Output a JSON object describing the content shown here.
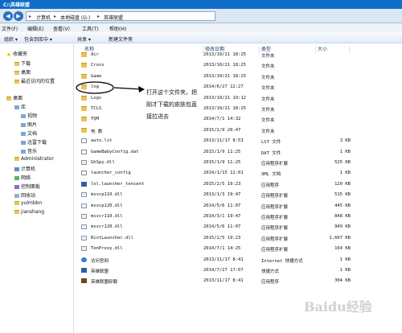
{
  "window": {
    "title": "C:\\英雄联盟"
  },
  "nav": {
    "back": "◀",
    "forward": "▶"
  },
  "address": {
    "c1": "计算机",
    "c2": "本地磁盘 (G:)",
    "c3": "英雄联盟",
    "sep": "▸"
  },
  "menu": {
    "file": "文件(F)",
    "edit": "编辑(E)",
    "view": "查看(V)",
    "tools": "工具(T)",
    "help": "帮助(H)"
  },
  "toolbar": {
    "organize": "组织 ▾",
    "include": "包含到库中 ▾",
    "share": "共享 ▾",
    "newfolder": "新建文件夹"
  },
  "sidebar": [
    {
      "label": "收藏夹",
      "icon": "star-icon"
    },
    {
      "label": "下载",
      "icon": "folder-icon"
    },
    {
      "label": "桌面",
      "icon": "folder-icon"
    },
    {
      "label": "最近访问的位置",
      "icon": "folder-icon"
    },
    {
      "label": "桌面",
      "icon": "folder-icon"
    },
    {
      "label": "库",
      "icon": "library-icon"
    },
    {
      "label": "视频",
      "icon": "library-icon"
    },
    {
      "label": "图片",
      "icon": "library-icon"
    },
    {
      "label": "文档",
      "icon": "library-icon"
    },
    {
      "label": "迅雷下载",
      "icon": "library-icon"
    },
    {
      "label": "音乐",
      "icon": "library-icon"
    },
    {
      "label": "Administrator",
      "icon": "folder-icon"
    },
    {
      "label": "计算机",
      "icon": "computer-icon"
    },
    {
      "label": "网络",
      "icon": "network-icon"
    },
    {
      "label": "控制面板",
      "icon": "control-panel-icon"
    },
    {
      "label": "回收站",
      "icon": "recycle-bin-icon"
    },
    {
      "label": "yulmbbn",
      "icon": "folder-icon"
    },
    {
      "label": "jianshang",
      "icon": "folder-icon"
    }
  ],
  "columns": {
    "name": "名称",
    "date": "修改日期",
    "type": "类型",
    "size": "大小"
  },
  "files": [
    {
      "name": "Air",
      "date": "2013/10/21 18:25",
      "type": "文件夹",
      "size": "",
      "kind": "folder"
    },
    {
      "name": "Cross",
      "date": "2013/10/21 18:25",
      "type": "文件夹",
      "size": "",
      "kind": "folder"
    },
    {
      "name": "Game",
      "date": "2013/10/21 18:25",
      "type": "文件夹",
      "size": "",
      "kind": "folder"
    },
    {
      "name": "log",
      "date": "2014/6/27 12:27",
      "type": "文件夹",
      "size": "",
      "kind": "folder"
    },
    {
      "name": "Logs",
      "date": "2013/10/21 19:12",
      "type": "文件夹",
      "size": "",
      "kind": "folder"
    },
    {
      "name": "TCLS",
      "date": "2013/10/21 18:25",
      "type": "文件夹",
      "size": "",
      "kind": "folder"
    },
    {
      "name": "TQM",
      "date": "2014/7/1 14:32",
      "type": "文件夹",
      "size": "",
      "kind": "folder"
    },
    {
      "name": "电 数",
      "date": "2015/2/9 20:47",
      "type": "文件夹",
      "size": "",
      "kind": "folder"
    },
    {
      "name": "auto.lst",
      "date": "2013/11/17 8:53",
      "type": "LST 文件",
      "size": "3 KB",
      "kind": "file"
    },
    {
      "name": "GameBabyConfig.dat",
      "date": "2015/1/9 11:25",
      "type": "DAT 文件",
      "size": "1 KB",
      "kind": "file"
    },
    {
      "name": "GhSpy.dll",
      "date": "2015/1/9 11:25",
      "type": "应用程序扩展",
      "size": "525 KB",
      "kind": "dll"
    },
    {
      "name": "launcher_config",
      "date": "2014/1/15 12:01",
      "type": "XML 文档",
      "size": "1 KB",
      "kind": "file"
    },
    {
      "name": "lol.launcher_tencent",
      "date": "2015/2/5 19:23",
      "type": "应用程序",
      "size": "120 KB",
      "kind": "app"
    },
    {
      "name": "msvcp110.dll",
      "date": "2013/1/3 19:47",
      "type": "应用程序扩展",
      "size": "515 KB",
      "kind": "dll"
    },
    {
      "name": "msvcp120.dll",
      "date": "2014/5/6 11:07",
      "type": "应用程序扩展",
      "size": "445 KB",
      "kind": "dll"
    },
    {
      "name": "msvcr110.dll",
      "date": "2014/3/1 19:47",
      "type": "应用程序扩展",
      "size": "848 KB",
      "kind": "dll"
    },
    {
      "name": "msvcr120.dll",
      "date": "2014/5/6 11:07",
      "type": "应用程序扩展",
      "size": "949 KB",
      "kind": "dll"
    },
    {
      "name": "RiotLauncher.dll",
      "date": "2015/2/5 19:23",
      "type": "应用程序扩展",
      "size": "1,607 KB",
      "kind": "dll"
    },
    {
      "name": "TenProxy.dll",
      "date": "2014/7/1 14:25",
      "type": "应用程序扩展",
      "size": "164 KB",
      "kind": "dll"
    },
    {
      "name": "访问官网",
      "date": "2013/11/17 8:41",
      "type": "Internet 快捷方式",
      "size": "1 KB",
      "kind": "web"
    },
    {
      "name": "英雄联盟",
      "date": "2014/7/27 17:07",
      "type": "快捷方式",
      "size": "1 KB",
      "kind": "app"
    },
    {
      "name": "英雄联盟卸载",
      "date": "2013/11/17 8:41",
      "type": "应用程序",
      "size": "304 KB",
      "kind": "game"
    }
  ],
  "annotation": {
    "line1": "打开这个文件夹，把",
    "line2": "刚才下载的皮肤包直",
    "line3": "接拉进去"
  },
  "watermark": "Baidu经验"
}
